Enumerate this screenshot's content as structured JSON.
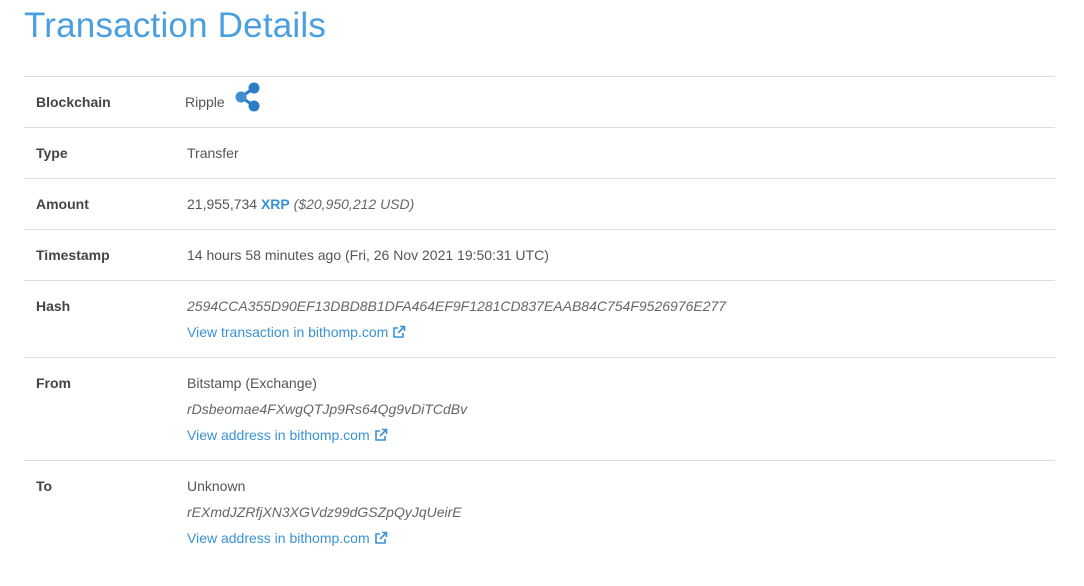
{
  "page": {
    "title": "Transaction Details"
  },
  "colors": {
    "accent": "#4a9fe0",
    "link": "#3a92d6",
    "ripple_logo": "#2a7dc4"
  },
  "icons": {
    "blockchain_logo": "ripple-logo-icon",
    "external_link": "external-link-icon"
  },
  "details": {
    "blockchain": {
      "label": "Blockchain",
      "value": "Ripple"
    },
    "type": {
      "label": "Type",
      "value": "Transfer"
    },
    "amount": {
      "label": "Amount",
      "value": "21,955,734",
      "currency": "XRP",
      "usd": "($20,950,212 USD)"
    },
    "timestamp": {
      "label": "Timestamp",
      "value": "14 hours 58 minutes ago (Fri, 26 Nov 2021 19:50:31 UTC)"
    },
    "hash": {
      "label": "Hash",
      "value": "2594CCA355D90EF13DBD8B1DFA464EF9F1281CD837EAAB84C754F9526976E277",
      "link_text": "View transaction in bithomp.com"
    },
    "from": {
      "label": "From",
      "owner": "Bitstamp (Exchange)",
      "address": "rDsbeomae4FXwgQTJp9Rs64Qg9vDiTCdBv",
      "link_text": "View address in bithomp.com"
    },
    "to": {
      "label": "To",
      "owner": "Unknown",
      "address": "rEXmdJZRfjXN3XGVdz99dGSZpQyJqUeirE",
      "link_text": "View address in bithomp.com"
    }
  }
}
